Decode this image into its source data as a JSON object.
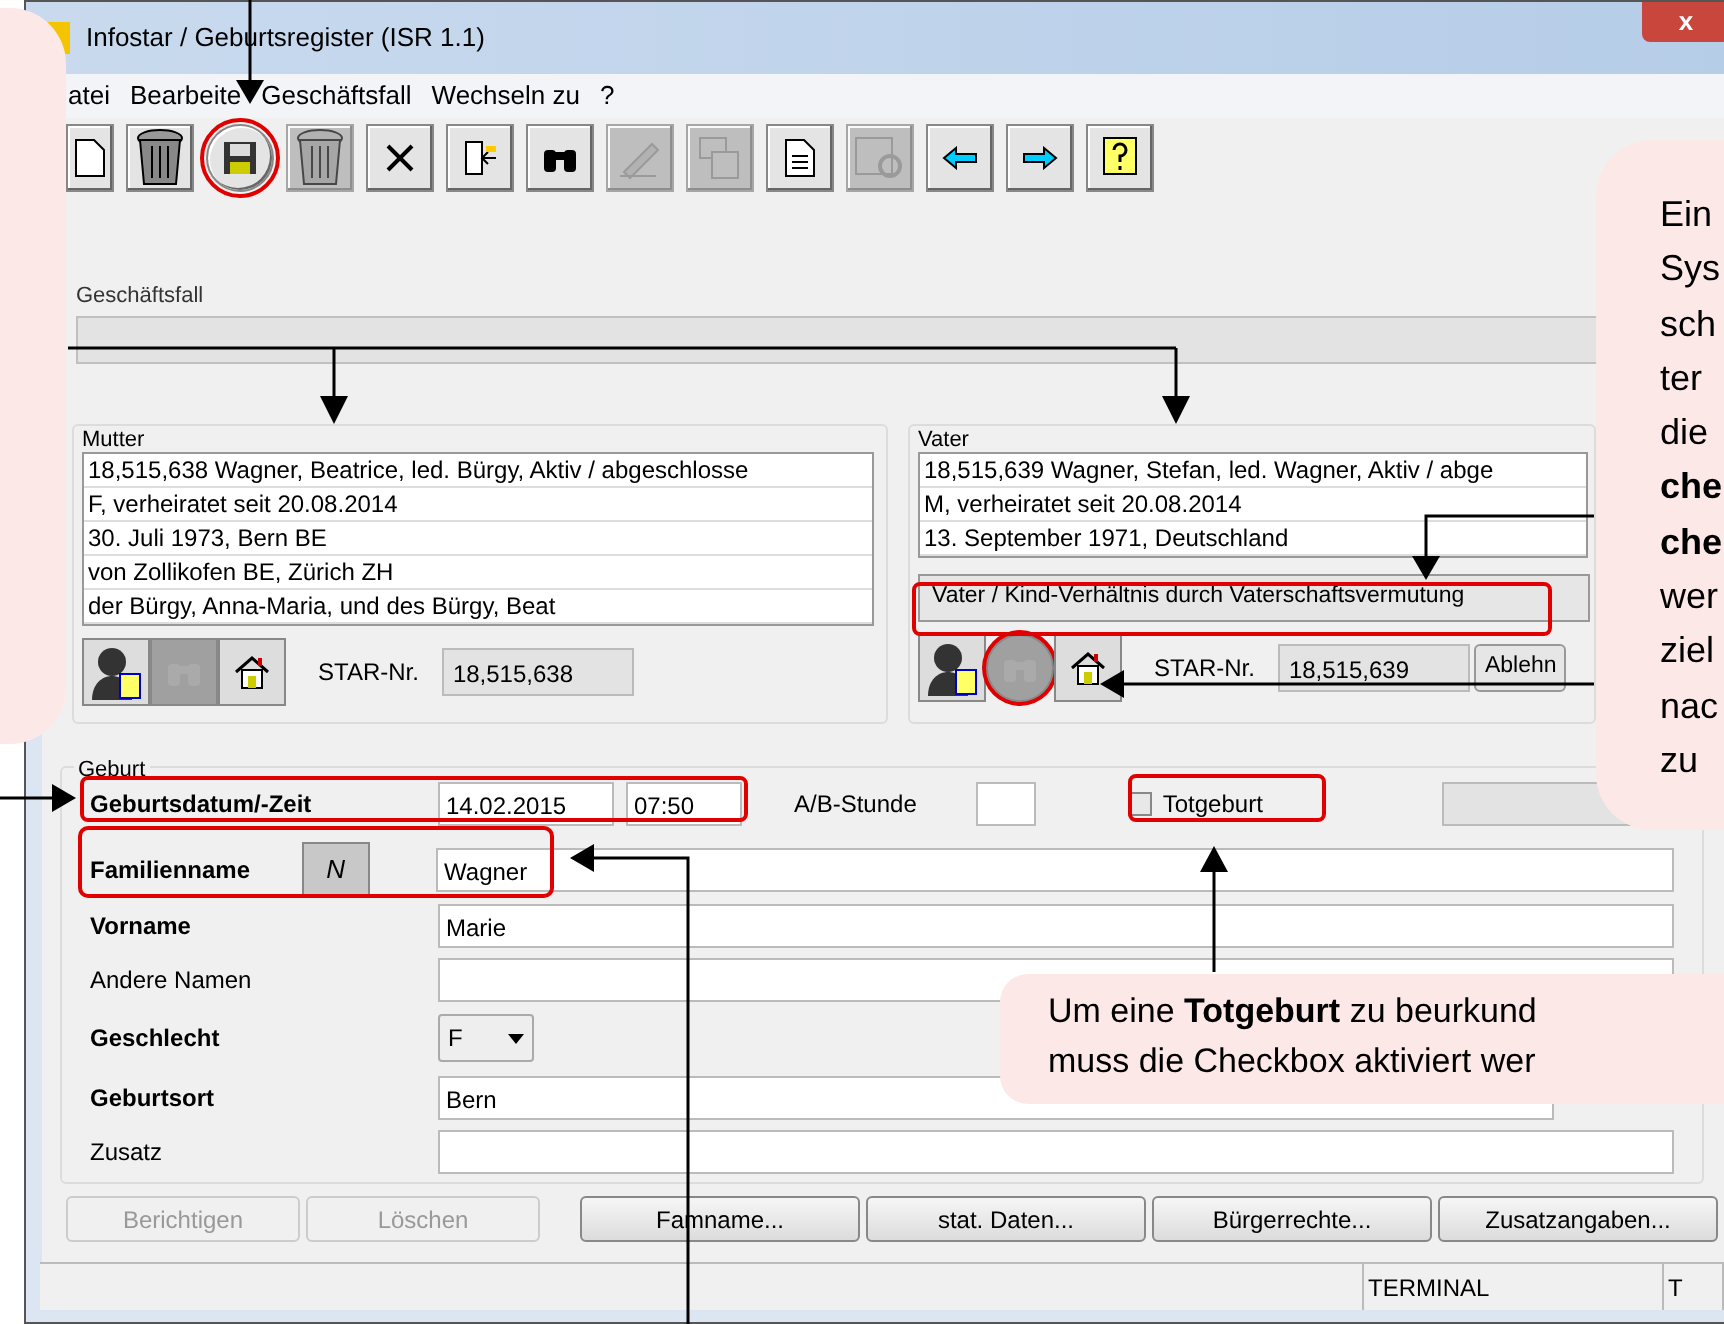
{
  "window": {
    "title": "Infostar / Geburtsregister (ISR 1.1)",
    "close": "x"
  },
  "menu": [
    {
      "label": "atei"
    },
    {
      "label": "Bearbeite"
    },
    {
      "label": "Geschäftsfall"
    },
    {
      "label": "Wechseln zu"
    },
    {
      "label": "?"
    }
  ],
  "toolbar": [
    {
      "kind": "new",
      "disabled": false,
      "highlighted": false
    },
    {
      "kind": "trash",
      "disabled": false,
      "highlighted": false
    },
    {
      "kind": "save",
      "disabled": false,
      "highlighted": true
    },
    {
      "kind": "trash",
      "disabled": true,
      "highlighted": false
    },
    {
      "kind": "close",
      "disabled": false,
      "highlighted": false
    },
    {
      "kind": "exit",
      "disabled": false,
      "highlighted": false
    },
    {
      "kind": "find",
      "disabled": false,
      "highlighted": false
    },
    {
      "kind": "sign",
      "disabled": true,
      "highlighted": false
    },
    {
      "kind": "copy",
      "disabled": true,
      "highlighted": false
    },
    {
      "kind": "document",
      "disabled": false,
      "highlighted": false
    },
    {
      "kind": "preview",
      "disabled": true,
      "highlighted": false
    },
    {
      "kind": "back",
      "disabled": false,
      "highlighted": false
    },
    {
      "kind": "forward",
      "disabled": false,
      "highlighted": false
    },
    {
      "kind": "help",
      "disabled": false,
      "highlighted": false
    }
  ],
  "geschaeftsfall": {
    "label": "Geschäftsfall"
  },
  "mutter": {
    "label": "Mutter",
    "lines": [
      "18,515,638  Wagner, Beatrice, led. Bürgy, Aktiv / abgeschlosse",
      "F, verheiratet seit 20.08.2014",
      "30. Juli 1973, Bern BE",
      "von Zollikofen BE, Zürich ZH",
      "der Bürgy, Anna-Maria, und des Bürgy, Beat"
    ],
    "find_highlighted": false,
    "star_label": "STAR-Nr.",
    "star_value": "18,515,638"
  },
  "vater": {
    "label": "Vater",
    "lines": [
      "18,515,639  Wagner, Stefan, led. Wagner, Aktiv / abge",
      "M, verheiratet seit 20.08.2014",
      "13. September 1971, Deutschland"
    ],
    "relation_button": "Vater / Kind-Verhältnis durch Vaterschaftsvermutung",
    "find_highlighted": true,
    "star_label": "STAR-Nr.",
    "star_value": "18,515,639",
    "reject_button": "Ablehn"
  },
  "geburt": {
    "label": "Geburt",
    "date_label": "Geburtsdatum/-Zeit",
    "date": "14.02.2015",
    "time": "07:50",
    "ab_label": "A/B-Stunde",
    "stillbirth": {
      "label": "Totgeburt",
      "checked": false
    },
    "family_name_label": "Familienname",
    "name_button": "N",
    "family_name": "Wagner",
    "first_name_label": "Vorname",
    "first_name": "Marie",
    "other_names_label": "Andere Namen",
    "sex_label": "Geschlecht",
    "sex": "F",
    "birthplace_label": "Geburtsort",
    "birthplace": "Bern",
    "addition_label": "Zusatz"
  },
  "buttons": [
    {
      "label": "Berichtigen",
      "disabled": true
    },
    {
      "label": "Löschen",
      "disabled": true
    },
    {
      "label": "Famname...",
      "disabled": false
    },
    {
      "label": "stat. Daten...",
      "disabled": false
    },
    {
      "label": "Bürgerrechte...",
      "disabled": false
    },
    {
      "label": "Zusatzangaben...",
      "disabled": false
    }
  ],
  "status_bar": [
    "TERMINAL",
    "T"
  ],
  "callouts": {
    "right": [
      "Ein",
      "Sys",
      "sch",
      "ter",
      "die",
      "**che**",
      "**che**",
      "wer",
      "ziel",
      "nac",
      "zu"
    ],
    "bottom": [
      "Um eine **Totgeburt** zu beurkund",
      "muss die Checkbox aktiviert wer"
    ]
  }
}
